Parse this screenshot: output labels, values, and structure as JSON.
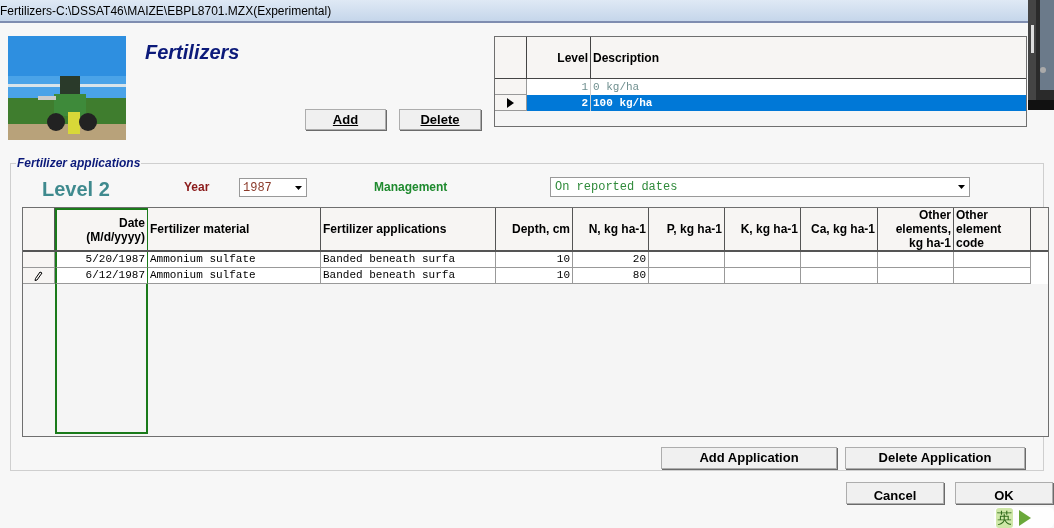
{
  "window": {
    "title": "Fertilizers-C:\\DSSAT46\\MAIZE\\EBPL8701.MZX(Experimental)"
  },
  "header": {
    "title": "Fertilizers"
  },
  "level_buttons": [
    "Add",
    "Delete"
  ],
  "levels": {
    "columns": [
      "Level",
      "Description"
    ],
    "rows": [
      {
        "level": "1",
        "description": "0 kg/ha",
        "selected": false
      },
      {
        "level": "2",
        "description": "100 kg/ha",
        "selected": true
      }
    ]
  },
  "applications": {
    "group_title": "Fertilizer applications",
    "level_label": "Level 2",
    "year_label": "Year",
    "year_value": "1987",
    "management_label": "Management",
    "management_value": "On reported dates",
    "table": {
      "columns": [
        {
          "label": "Date\n(M/d/yyyy)",
          "selected": true
        },
        {
          "label": "Fertilizer material",
          "selected": false
        },
        {
          "label": "Fertilizer applications",
          "selected": false
        },
        {
          "label": "Depth, cm",
          "selected": false
        },
        {
          "label": "N, kg ha-1",
          "selected": false
        },
        {
          "label": "P, kg ha-1",
          "selected": false
        },
        {
          "label": "K, kg ha-1",
          "selected": false
        },
        {
          "label": "Ca, kg ha-1",
          "selected": false
        },
        {
          "label": "Other\nelements,\nkg ha-1",
          "selected": false
        },
        {
          "label": "Other\nelement\ncode",
          "selected": false
        }
      ],
      "rows": [
        {
          "editing": false,
          "cells": [
            "5/20/1987",
            "Ammonium sulfate",
            "Banded beneath surfa",
            "10",
            "20"
          ]
        },
        {
          "editing": true,
          "cells": [
            "6/12/1987",
            "Ammonium sulfate",
            "Banded beneath surfa",
            "10",
            "80"
          ]
        }
      ]
    },
    "buttons": [
      "Add Application",
      "Delete Application"
    ]
  },
  "dialog_buttons": [
    "Cancel",
    "OK"
  ],
  "ime_toolbar": {
    "label": "英"
  }
}
